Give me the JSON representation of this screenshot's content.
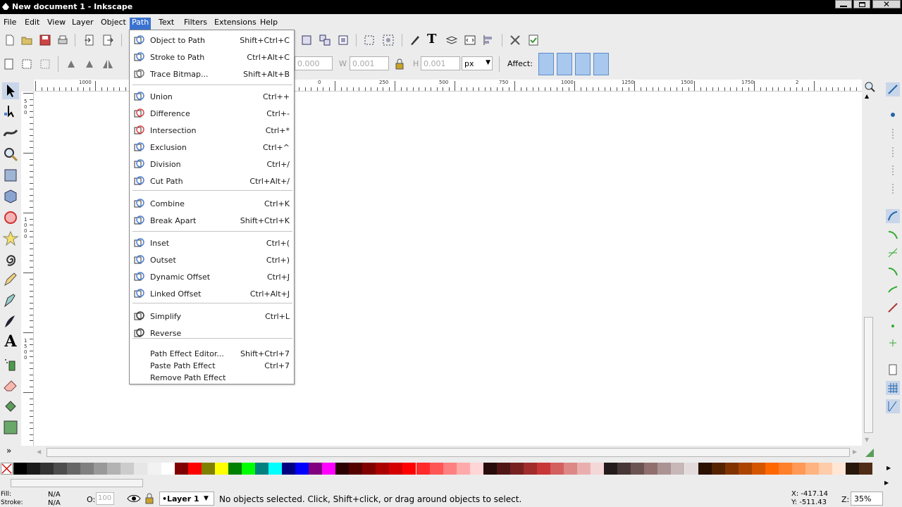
{
  "window": {
    "title": "New document 1 - Inkscape"
  },
  "menubar": {
    "items": [
      {
        "label": "File"
      },
      {
        "label": "Edit"
      },
      {
        "label": "View"
      },
      {
        "label": "Layer"
      },
      {
        "label": "Object"
      },
      {
        "label": "Path",
        "active": true
      },
      {
        "label": "Text"
      },
      {
        "label": "Filters"
      },
      {
        "label": "Extensions"
      },
      {
        "label": "Help"
      }
    ]
  },
  "path_menu": {
    "groups": [
      [
        {
          "label": "Object to Path",
          "shortcut": "Shift+Ctrl+C",
          "icon": "object-to-path-icon"
        },
        {
          "label": "Stroke to Path",
          "shortcut": "Ctrl+Alt+C",
          "icon": "stroke-to-path-icon"
        },
        {
          "label": "Trace Bitmap...",
          "shortcut": "Shift+Alt+B",
          "icon": "trace-bitmap-icon"
        }
      ],
      [
        {
          "label": "Union",
          "shortcut": "Ctrl++",
          "icon": "union-icon"
        },
        {
          "label": "Difference",
          "shortcut": "Ctrl+-",
          "icon": "difference-icon"
        },
        {
          "label": "Intersection",
          "shortcut": "Ctrl+*",
          "icon": "intersection-icon"
        },
        {
          "label": "Exclusion",
          "shortcut": "Ctrl+^",
          "icon": "exclusion-icon"
        },
        {
          "label": "Division",
          "shortcut": "Ctrl+/",
          "icon": "division-icon"
        },
        {
          "label": "Cut Path",
          "shortcut": "Ctrl+Alt+/",
          "icon": "cut-path-icon"
        }
      ],
      [
        {
          "label": "Combine",
          "shortcut": "Ctrl+K",
          "icon": "combine-icon"
        },
        {
          "label": "Break Apart",
          "shortcut": "Shift+Ctrl+K",
          "icon": "break-apart-icon"
        }
      ],
      [
        {
          "label": "Inset",
          "shortcut": "Ctrl+(",
          "icon": "inset-icon"
        },
        {
          "label": "Outset",
          "shortcut": "Ctrl+)",
          "icon": "outset-icon"
        },
        {
          "label": "Dynamic Offset",
          "shortcut": "Ctrl+J",
          "icon": "dynamic-offset-icon"
        },
        {
          "label": "Linked Offset",
          "shortcut": "Ctrl+Alt+J",
          "icon": "linked-offset-icon"
        }
      ],
      [
        {
          "label": "Simplify",
          "shortcut": "Ctrl+L",
          "icon": "simplify-icon"
        },
        {
          "label": "Reverse",
          "shortcut": "",
          "icon": "reverse-icon"
        }
      ],
      [
        {
          "label": "Path Effect Editor...",
          "shortcut": "Shift+Ctrl+7",
          "icon": ""
        },
        {
          "label": "Paste Path Effect",
          "shortcut": "Ctrl+7",
          "icon": ""
        },
        {
          "label": "Remove Path Effect",
          "shortcut": "",
          "icon": ""
        }
      ]
    ]
  },
  "select_toolbar": {
    "x_value": "0.000",
    "w_label": "W",
    "w_value": "0.001",
    "h_label": "H",
    "h_value": "0.001",
    "unit": "px",
    "affect_label": "Affect:"
  },
  "rulers": {
    "h_labels": [
      "1000",
      "0",
      "250",
      "500",
      "750",
      "1000",
      "1250",
      "1500",
      "1750",
      "2"
    ],
    "v_labels": [
      "500",
      "1000",
      "1500"
    ]
  },
  "status": {
    "fill_label": "Fill:",
    "fill_value": "N/A",
    "stroke_label": "Stroke:",
    "stroke_value": "N/A",
    "opacity_label": "O:",
    "opacity_value": "100",
    "layer": "•Layer 1",
    "message": "No objects selected. Click, Shift+click, or drag around objects to select.",
    "x_coord": "X: -417.14",
    "y_coord": "Y: -511.43",
    "zoom_label": "Z:",
    "zoom_value": "35%"
  },
  "palette": {
    "colors": [
      "#000000",
      "#1a1a1a",
      "#333333",
      "#4d4d4d",
      "#666666",
      "#808080",
      "#999999",
      "#b3b3b3",
      "#cccccc",
      "#e6e6e6",
      "#f2f2f2",
      "#ffffff",
      "#800000",
      "#ff0000",
      "#808000",
      "#ffff00",
      "#008000",
      "#00ff00",
      "#008080",
      "#00ffff",
      "#000080",
      "#0000ff",
      "#800080",
      "#ff00ff",
      "#2b0000",
      "#550000",
      "#800000",
      "#aa0000",
      "#d40000",
      "#ff0000",
      "#ff2a2a",
      "#ff5555",
      "#ff8080",
      "#ffaaaa",
      "#ffd5d5",
      "#280b0b",
      "#501616",
      "#782121",
      "#a02c2c",
      "#c83737",
      "#d35f5f",
      "#de8787",
      "#e9afaf",
      "#f4d7d7",
      "#241c1c",
      "#483737",
      "#6c5353",
      "#916f6f",
      "#ac9393",
      "#c8b7b7",
      "#e3dbdb",
      "#2b1100",
      "#552200",
      "#803300",
      "#aa4400",
      "#d45500",
      "#ff6600",
      "#ff7f2a",
      "#ff9955",
      "#ffb380",
      "#ffccaa",
      "#ffe6d5",
      "#28170b",
      "#502d16"
    ]
  }
}
